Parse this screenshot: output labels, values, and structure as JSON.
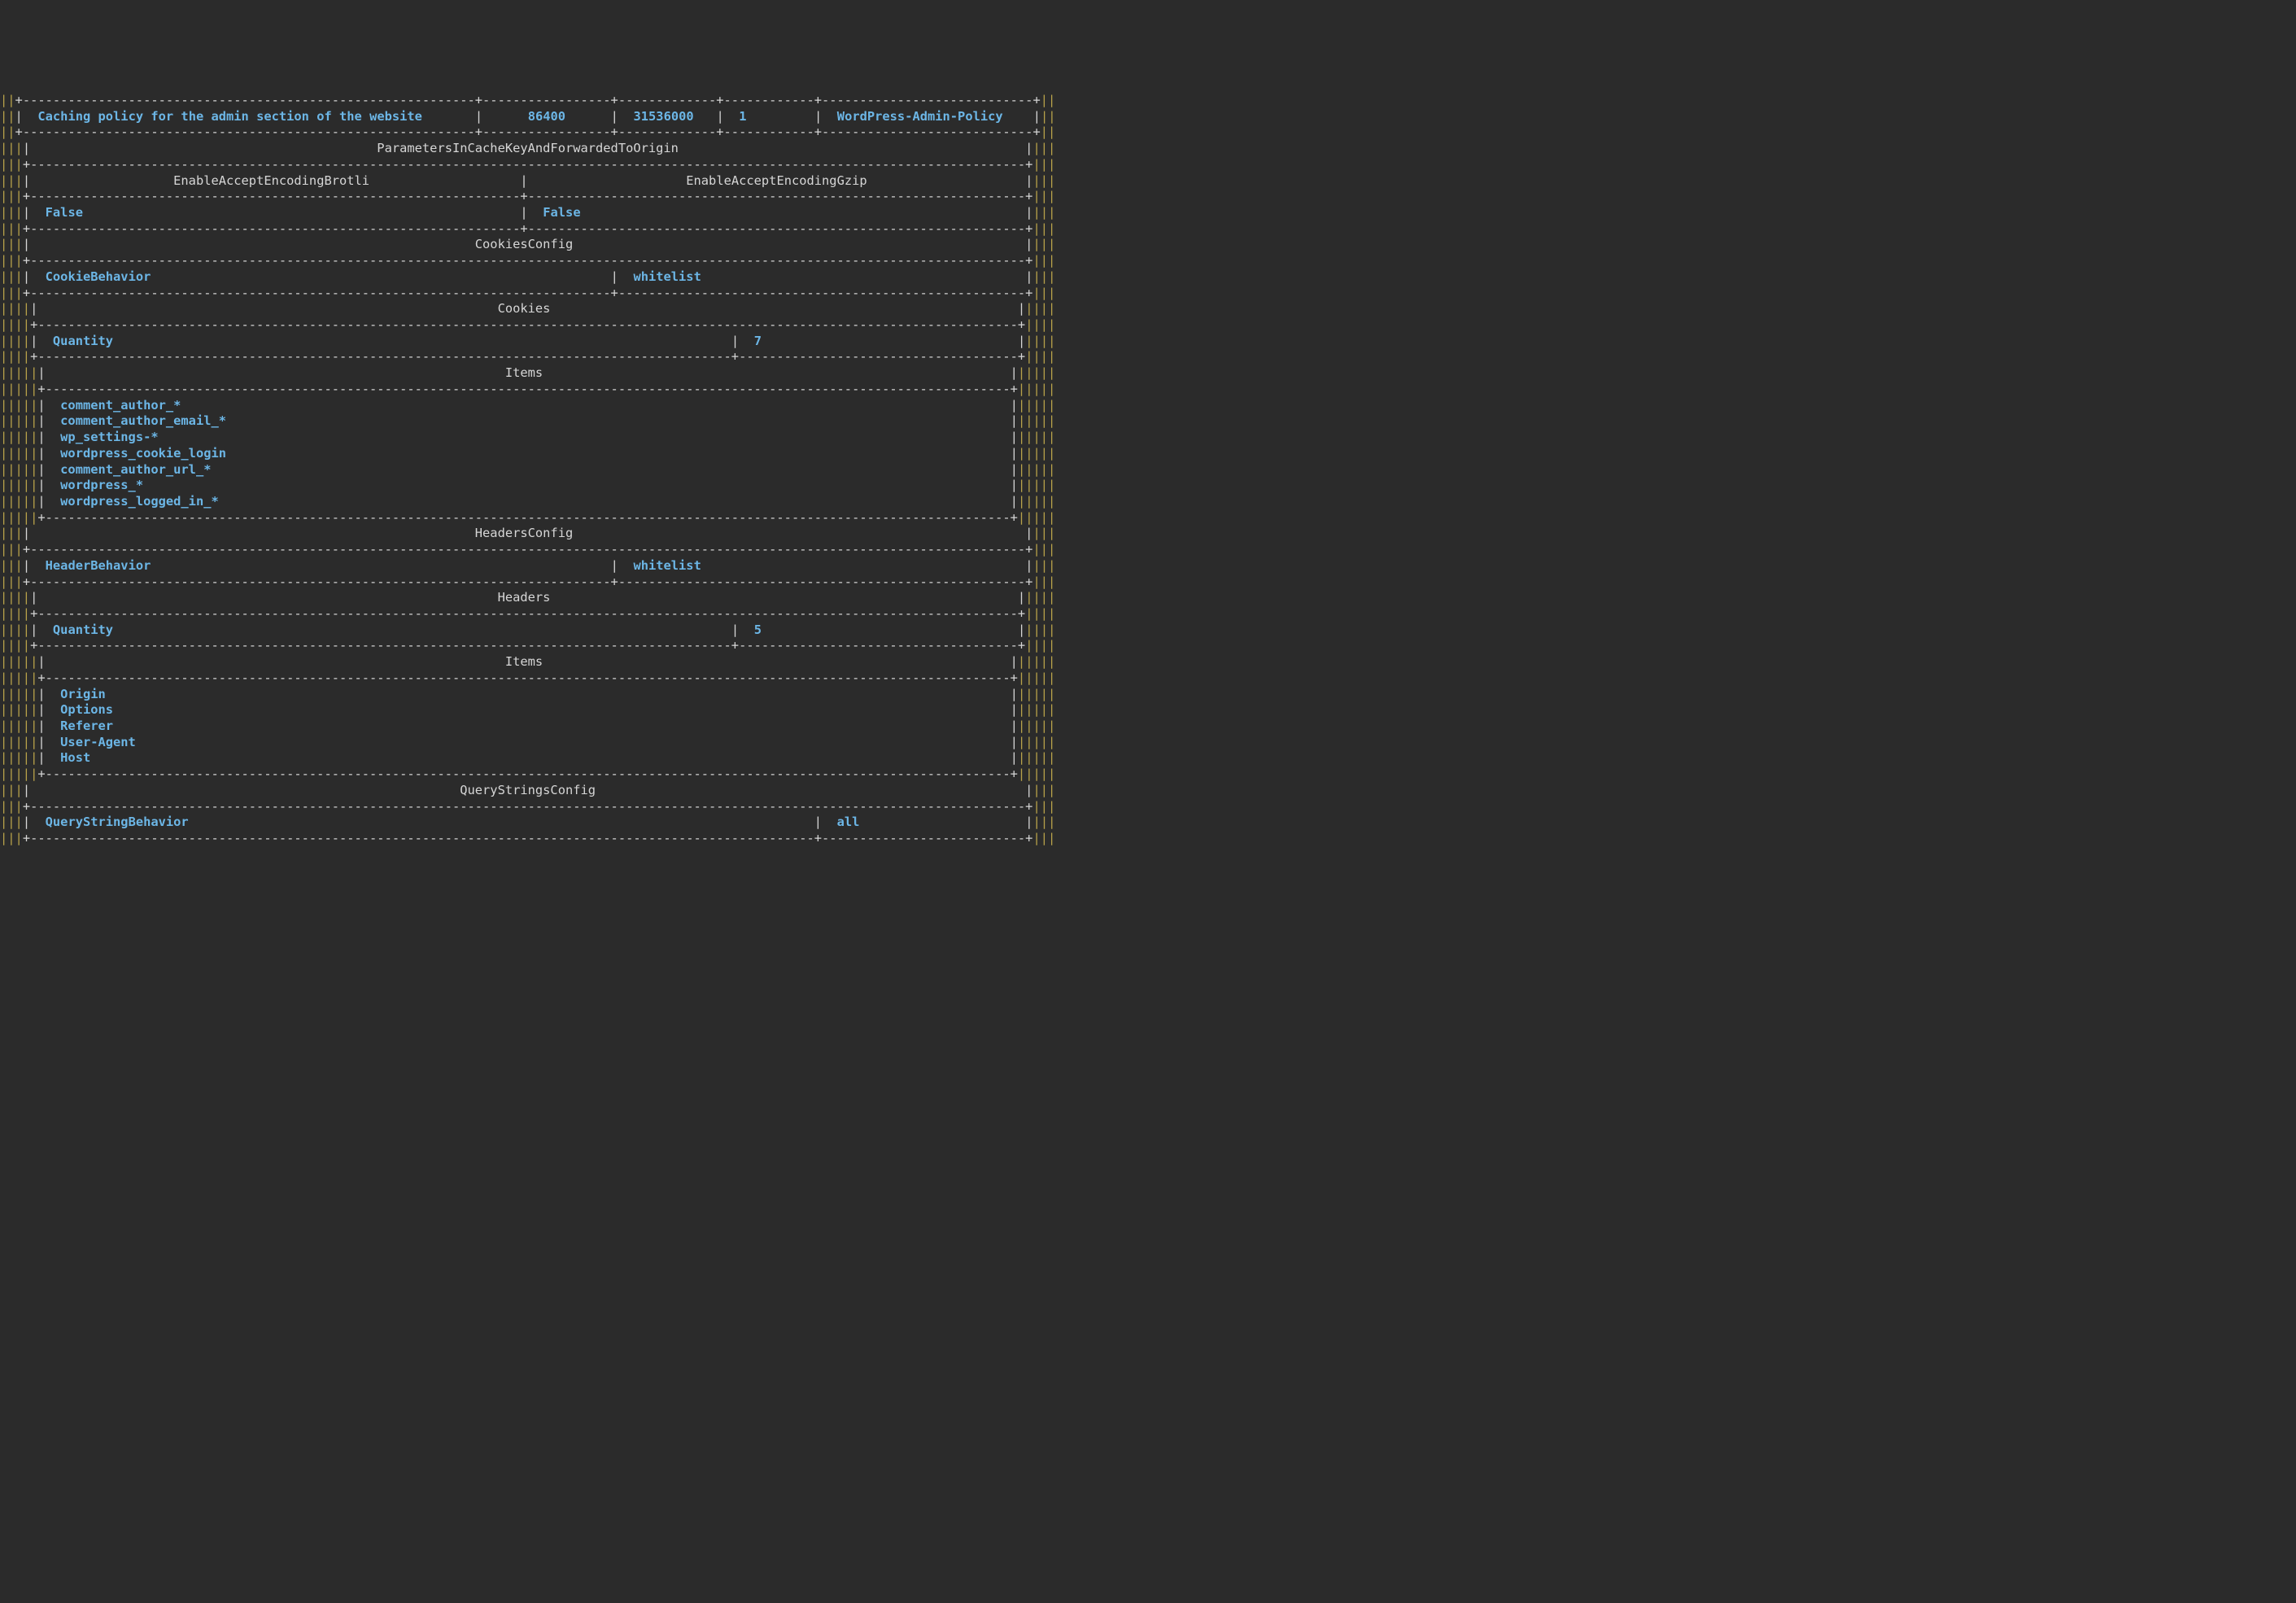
{
  "row1": {
    "desc": "Caching policy for the admin section of the website",
    "v1": "86400",
    "v2": "31536000",
    "v3": "1",
    "v4": "WordPress-Admin-Policy"
  },
  "params_title": "ParametersInCacheKeyAndForwardedToOrigin",
  "enc": {
    "h1": "EnableAcceptEncodingBrotli",
    "h2": "EnableAcceptEncodingGzip",
    "v1": "False",
    "v2": "False"
  },
  "cookies": {
    "title": "CookiesConfig",
    "behavior_label": "CookieBehavior",
    "behavior_value": "whitelist",
    "sub": "Cookies",
    "qty_label": "Quantity",
    "qty_value": "7",
    "items_title": "Items",
    "items": [
      "comment_author_*",
      "comment_author_email_*",
      "wp_settings-*",
      "wordpress_cookie_login",
      "comment_author_url_*",
      "wordpress_*",
      "wordpress_logged_in_*"
    ]
  },
  "headers": {
    "title": "HeadersConfig",
    "behavior_label": "HeaderBehavior",
    "behavior_value": "whitelist",
    "sub": "Headers",
    "qty_label": "Quantity",
    "qty_value": "5",
    "items_title": "Items",
    "items": [
      "Origin",
      "Options",
      "Referer",
      "User-Agent",
      "Host"
    ]
  },
  "qs": {
    "title": "QueryStringsConfig",
    "behavior_label": "QueryStringBehavior",
    "behavior_value": "all"
  }
}
